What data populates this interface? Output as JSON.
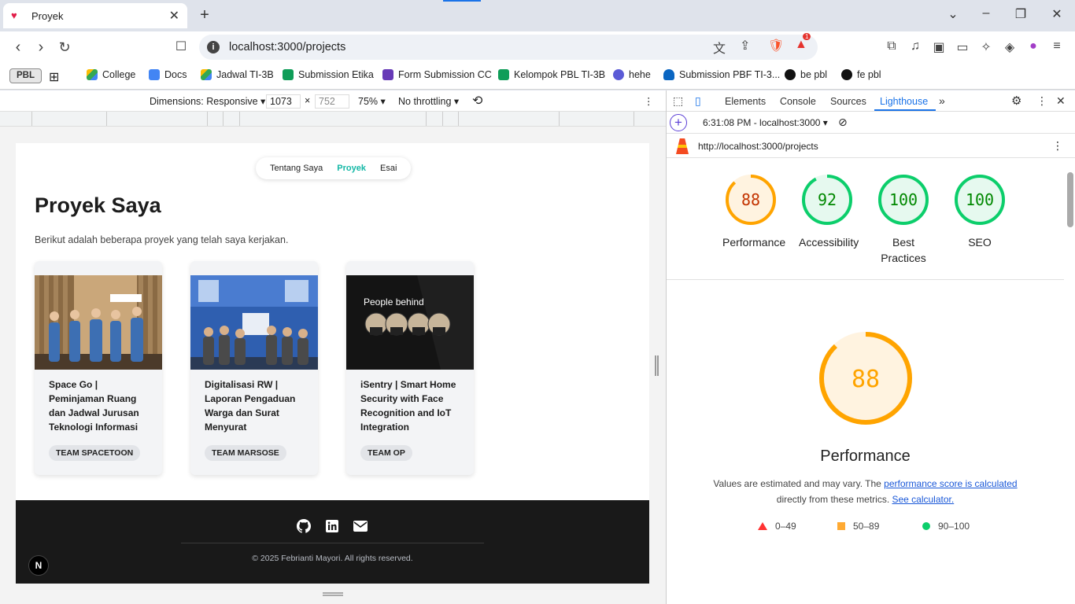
{
  "browser": {
    "tab_title": "Proyek",
    "url": "localhost:3000/projects",
    "bookmarks": [
      {
        "label": "PBL"
      },
      {
        "label": "College"
      },
      {
        "label": "Docs"
      },
      {
        "label": "Jadwal TI-3B"
      },
      {
        "label": "Submission Etika"
      },
      {
        "label": "Form Submission CC"
      },
      {
        "label": "Kelompok PBL TI-3B"
      },
      {
        "label": "hehe"
      },
      {
        "label": "Submission PBF TI-3..."
      },
      {
        "label": "be pbl"
      },
      {
        "label": "fe pbl"
      }
    ],
    "notification_count": "1"
  },
  "device_toolbar": {
    "dimensions": "Dimensions: Responsive",
    "width": "1073",
    "height_placeholder": "752",
    "times": "×",
    "zoom": "75%",
    "throttling": "No throttling"
  },
  "page": {
    "nav": [
      "Tentang Saya",
      "Proyek",
      "Esai"
    ],
    "heading": "Proyek Saya",
    "description": "Berikut adalah beberapa proyek yang telah saya kerjakan.",
    "projects": [
      {
        "title": "Space Go | Peminjaman Ruang dan Jadwal Jurusan Teknologi Informasi",
        "team": "TEAM SPACETOON"
      },
      {
        "title": "Digitalisasi RW | Laporan Pengaduan Warga dan Surat Menyurat",
        "team": "TEAM MARSOSE"
      },
      {
        "title": "iSentry | Smart Home Security with Face Recognition and IoT Integration",
        "team": "TEAM OP",
        "image_text": "People behind"
      }
    ],
    "footer_copyright": "© 2025 Febrianti Mayori. All rights reserved.",
    "next_badge": "N"
  },
  "devtools": {
    "tabs": [
      "Elements",
      "Console",
      "Sources",
      "Lighthouse"
    ],
    "active_tab": "Lighthouse",
    "report_time": "6:31:08 PM - localhost:3000",
    "report_url": "http://localhost:3000/projects",
    "scores": [
      {
        "value": 88,
        "label": "Performance",
        "color": "#ffa400",
        "bg": "#fff3e0",
        "text": "#c33300"
      },
      {
        "value": 92,
        "label": "Accessibility",
        "color": "#0cce6b",
        "bg": "#e6f9ef",
        "text": "#008800"
      },
      {
        "value": 100,
        "label": "Best Practices",
        "color": "#0cce6b",
        "bg": "#e6f9ef",
        "text": "#008800"
      },
      {
        "value": 100,
        "label": "SEO",
        "color": "#0cce6b",
        "bg": "#e6f9ef",
        "text": "#008800"
      }
    ],
    "main_score": {
      "value": 88,
      "label": "Performance",
      "color": "#ffa400"
    },
    "note_text_1": "Values are estimated and may vary. The ",
    "note_link_1": "performance score is calculated",
    "note_text_2": "directly from these metrics. ",
    "note_link_2": "See calculator.",
    "legend": [
      {
        "range": "0–49",
        "color": "#ff3333",
        "shape": "triangle"
      },
      {
        "range": "50–89",
        "color": "#ffaa33",
        "shape": "square"
      },
      {
        "range": "90–100",
        "color": "#0cce6b",
        "shape": "circle"
      }
    ]
  }
}
